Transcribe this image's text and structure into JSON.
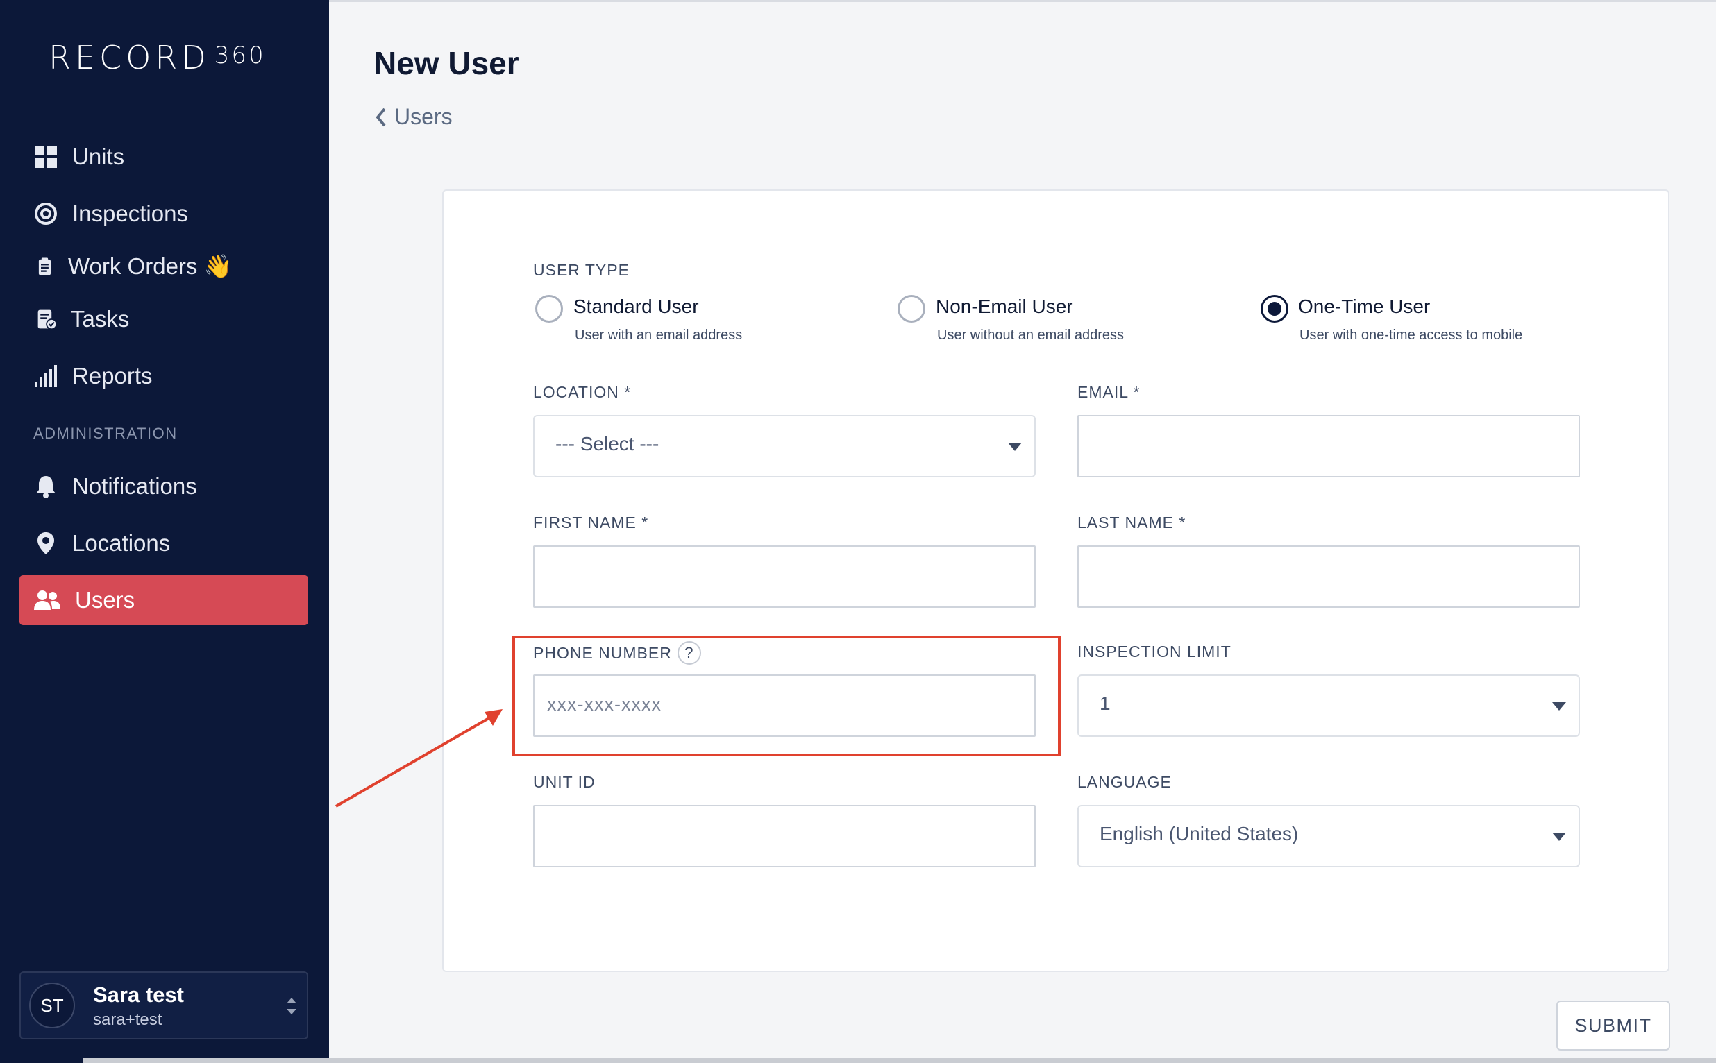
{
  "sidebar": {
    "logo_text": "RECORD",
    "logo_number": "360",
    "nav": [
      {
        "label": "Units",
        "icon": "grid-icon"
      },
      {
        "label": "Inspections",
        "icon": "target-icon"
      },
      {
        "label": "Work Orders 👋",
        "icon": "clipboard-icon"
      },
      {
        "label": "Tasks",
        "icon": "task-check-icon"
      },
      {
        "label": "Reports",
        "icon": "bar-chart-icon"
      }
    ],
    "admin_heading": "ADMINISTRATION",
    "admin_nav": [
      {
        "label": "Notifications",
        "icon": "bell-icon"
      },
      {
        "label": "Locations",
        "icon": "map-pin-icon"
      },
      {
        "label": "Users",
        "icon": "users-icon",
        "active": true
      }
    ],
    "user": {
      "initials": "ST",
      "name": "Sara test",
      "email": "sara+test"
    }
  },
  "header": {
    "title": "New User",
    "back_label": "Users"
  },
  "form": {
    "user_type_label": "USER TYPE",
    "user_types": [
      {
        "title": "Standard User",
        "desc": "User with an email address",
        "checked": false
      },
      {
        "title": "Non-Email User",
        "desc": "User without an email address",
        "checked": false
      },
      {
        "title": "One-Time User",
        "desc": "User with one-time access to mobile",
        "checked": true
      }
    ],
    "location": {
      "label": "LOCATION *",
      "value": "--- Select ---"
    },
    "email": {
      "label": "EMAIL *",
      "value": ""
    },
    "first_name": {
      "label": "FIRST NAME *",
      "value": ""
    },
    "last_name": {
      "label": "LAST NAME *",
      "value": ""
    },
    "phone": {
      "label": "PHONE NUMBER",
      "help": "?",
      "placeholder": "xxx-xxx-xxxx"
    },
    "inspection_limit": {
      "label": "INSPECTION LIMIT",
      "value": "1"
    },
    "unit_id": {
      "label": "UNIT ID",
      "value": ""
    },
    "language": {
      "label": "LANGUAGE",
      "value": "English (United States)"
    },
    "submit_label": "SUBMIT"
  },
  "annotation": {
    "color": "#e0412e"
  },
  "colors": {
    "sidebar_bg": "#0c1839",
    "active_nav": "#d64a55"
  }
}
